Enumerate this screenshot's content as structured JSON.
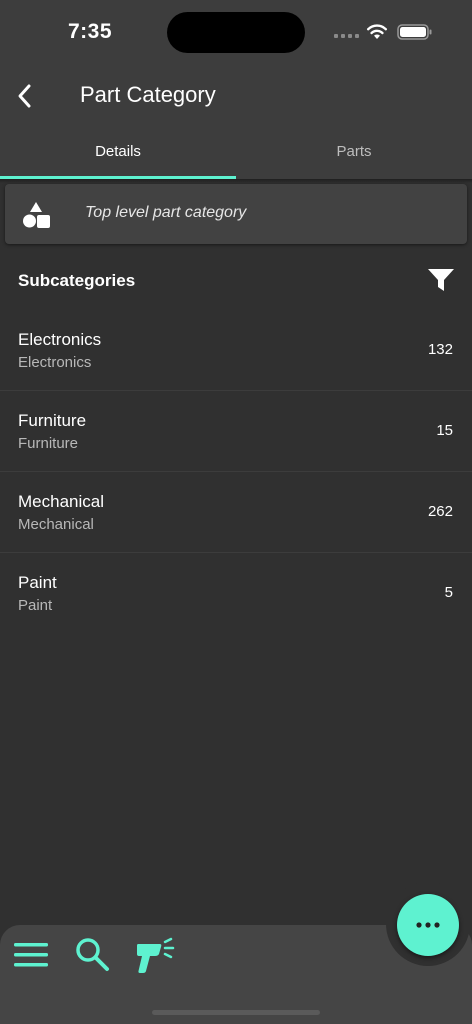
{
  "status_bar": {
    "time": "7:35"
  },
  "header": {
    "title": "Part Category"
  },
  "tabs": [
    {
      "label": "Details",
      "active": true
    },
    {
      "label": "Parts",
      "active": false
    }
  ],
  "category_card": {
    "description": "Top level part category",
    "icon": "shapes-icon"
  },
  "subcategories": {
    "title": "Subcategories",
    "items": [
      {
        "name": "Electronics",
        "description": "Electronics",
        "count": "132"
      },
      {
        "name": "Furniture",
        "description": "Furniture",
        "count": "15"
      },
      {
        "name": "Mechanical",
        "description": "Mechanical",
        "count": "262"
      },
      {
        "name": "Paint",
        "description": "Paint",
        "count": "5"
      }
    ]
  },
  "bottom_nav": {
    "items": [
      "menu-icon",
      "search-icon",
      "barcode-scanner-icon"
    ]
  },
  "fab": {
    "icon": "more-horizontal-icon"
  },
  "colors": {
    "accent": "#5ef2d0",
    "background": "#303030",
    "appbar": "#3d3d3d",
    "card": "#424242"
  }
}
